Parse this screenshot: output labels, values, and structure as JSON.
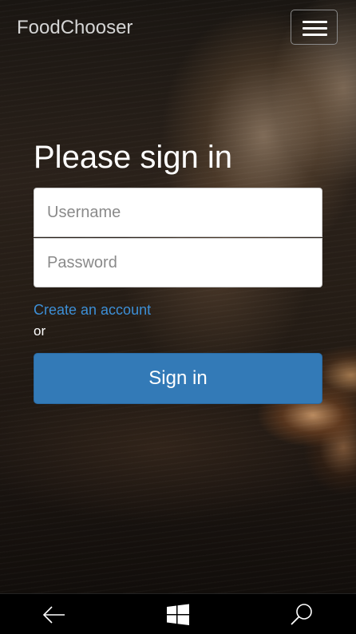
{
  "app": {
    "brand": "FoodChooser",
    "menu_icon": "hamburger-menu-icon"
  },
  "login": {
    "heading": "Please sign in",
    "username_placeholder": "Username",
    "password_placeholder": "Password",
    "create_account_label": "Create an account",
    "or_text": "or",
    "signin_label": "Sign in"
  },
  "taskbar": {
    "back_icon": "back-arrow-icon",
    "start_icon": "windows-logo-icon",
    "search_icon": "search-icon"
  },
  "colors": {
    "primary": "#337ab7",
    "link": "#3d8fd6",
    "brand_text": "#d4d4d4"
  }
}
